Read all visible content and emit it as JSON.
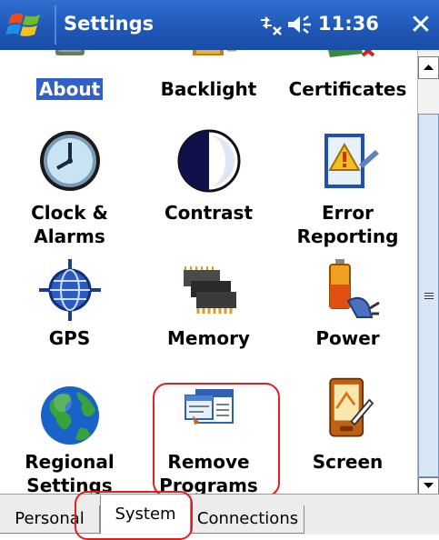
{
  "window": {
    "title": "Settings",
    "time": "11:36",
    "close_label": "✕"
  },
  "icons": {
    "start": "windows-flag-icon",
    "connectivity": "connectivity-icon",
    "volume": "volume-icon"
  },
  "settings_items": [
    {
      "label": "About",
      "icon": "about-icon",
      "selected": true
    },
    {
      "label": "Backlight",
      "icon": "backlight-icon"
    },
    {
      "label": "Certificates",
      "icon": "certificates-icon"
    },
    {
      "label": "Clock &\nAlarms",
      "icon": "clock-icon"
    },
    {
      "label": "Contrast",
      "icon": "contrast-icon"
    },
    {
      "label": "Error\nReporting",
      "icon": "error-reporting-icon"
    },
    {
      "label": "GPS",
      "icon": "gps-icon"
    },
    {
      "label": "Memory",
      "icon": "memory-icon"
    },
    {
      "label": "Power",
      "icon": "power-icon"
    },
    {
      "label": "Regional\nSettings",
      "icon": "globe-icon"
    },
    {
      "label": "Remove\nPrograms",
      "icon": "remove-programs-icon"
    },
    {
      "label": "Screen",
      "icon": "screen-icon"
    }
  ],
  "tabs": [
    {
      "label": "Personal",
      "active": false
    },
    {
      "label": "System",
      "active": true
    },
    {
      "label": "Connections",
      "active": false
    }
  ],
  "colors": {
    "title_bar": "#1f58b8",
    "selection": "#3060c8",
    "annotation": "#e02020"
  }
}
